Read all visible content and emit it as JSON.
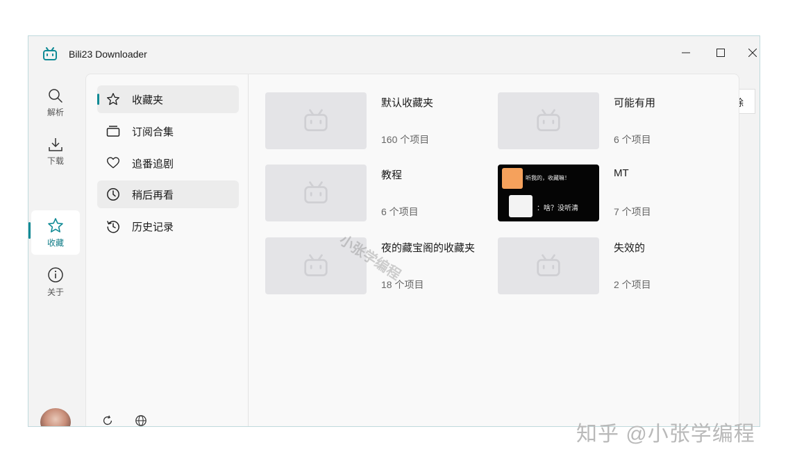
{
  "window": {
    "title": "Bili23 Downloader",
    "icon": "bilibili-tv-icon",
    "controls": [
      "minimize-icon",
      "maximize-icon",
      "close-icon"
    ]
  },
  "nav": {
    "items": [
      {
        "label": "解析",
        "icon": "search-icon"
      },
      {
        "label": "下载",
        "icon": "download-icon"
      },
      {
        "label": "收藏",
        "icon": "star-icon",
        "active": true
      },
      {
        "label": "关于",
        "icon": "info-icon"
      }
    ]
  },
  "sidebar": {
    "items": [
      {
        "label": "收藏夹",
        "icon": "star-icon",
        "selected": true
      },
      {
        "label": "订阅合集",
        "icon": "collection-icon"
      },
      {
        "label": "追番追剧",
        "icon": "heart-icon"
      },
      {
        "label": "稍后再看",
        "icon": "clock-icon"
      },
      {
        "label": "历史记录",
        "icon": "history-icon"
      }
    ],
    "bottom_icons": [
      "refresh-icon",
      "globe-icon"
    ]
  },
  "folders": [
    {
      "title": "默认收藏夹",
      "count": "160 个项目"
    },
    {
      "title": "可能有用",
      "count": "6 个项目"
    },
    {
      "title": "教程",
      "count": "6 个项目"
    },
    {
      "title": "MT",
      "count": "7 个项目",
      "cover": {
        "line1": "听我的，收藏嘛！",
        "line2": "：啥？没听清"
      }
    },
    {
      "title": "夜的藏宝阁的收藏夹",
      "count": "18 个项目"
    },
    {
      "title": "失效的",
      "count": "2 个项目"
    }
  ],
  "background_button": {
    "label": "除"
  },
  "watermarks": {
    "center": "小张学编程",
    "corner": "知乎 @小张学编程"
  },
  "colors": {
    "accent": "#0f8a95",
    "placeholder": "#e4e4e7"
  }
}
